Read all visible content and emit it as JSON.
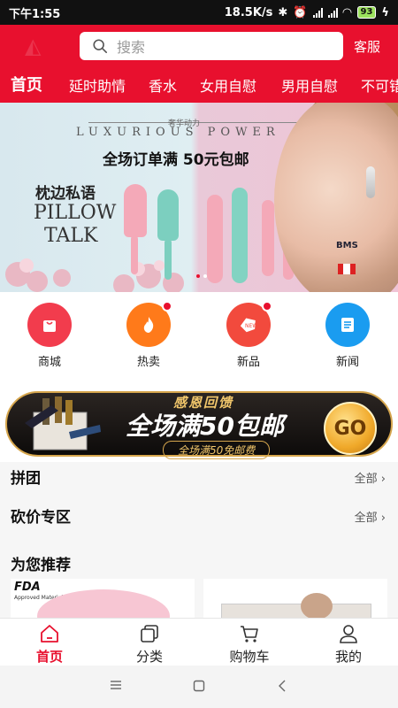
{
  "status_bar": {
    "time": "下午1:55",
    "speed": "18.5K/s",
    "battery": "93"
  },
  "header": {
    "search_placeholder": "搜索",
    "service": "客服",
    "tabs": [
      "首页",
      "延时助情",
      "香水",
      "女用自慰",
      "男用自慰",
      "不可错"
    ]
  },
  "banner": {
    "small_text": "奢华动力",
    "english_line": "LUXURIOUS POWER",
    "headline": "全场订单满  50元包邮",
    "product_cn": "枕边私语",
    "product_en_1": "PILLOW",
    "product_en_2": "TALK",
    "brand_tag": "BMS"
  },
  "quick_icons": [
    {
      "label": "商城",
      "icon": "shopping-bag-icon",
      "color": "#f23c4d",
      "badge": false
    },
    {
      "label": "热卖",
      "icon": "flame-icon",
      "color": "#ff7a1a",
      "badge": true
    },
    {
      "label": "新品",
      "icon": "new-tag-icon",
      "color": "#f24a3d",
      "badge": true
    },
    {
      "label": "新闻",
      "icon": "news-icon",
      "color": "#1a9cf0",
      "badge": false
    }
  ],
  "promo": {
    "top": "感恩回馈",
    "main": "全场满50包邮",
    "sub": "全场满50免邮费",
    "go": "GO"
  },
  "sections": {
    "group_buy": {
      "title": "拼团",
      "more": "全部"
    },
    "bargain": {
      "title": "砍价专区",
      "more": "全部"
    },
    "recommend": {
      "title": "为您推荐"
    }
  },
  "recommend_card": {
    "fda_label": "FDA",
    "fda_sub": "Approved Material"
  },
  "bottom_nav": [
    {
      "label": "首页",
      "icon": "home-icon",
      "active": true
    },
    {
      "label": "分类",
      "icon": "category-icon",
      "active": false
    },
    {
      "label": "购物车",
      "icon": "cart-icon",
      "active": false
    },
    {
      "label": "我的",
      "icon": "user-icon",
      "active": false
    }
  ],
  "colors": {
    "brand_red": "#e8102e",
    "promo_gold": "#f1c66b"
  }
}
